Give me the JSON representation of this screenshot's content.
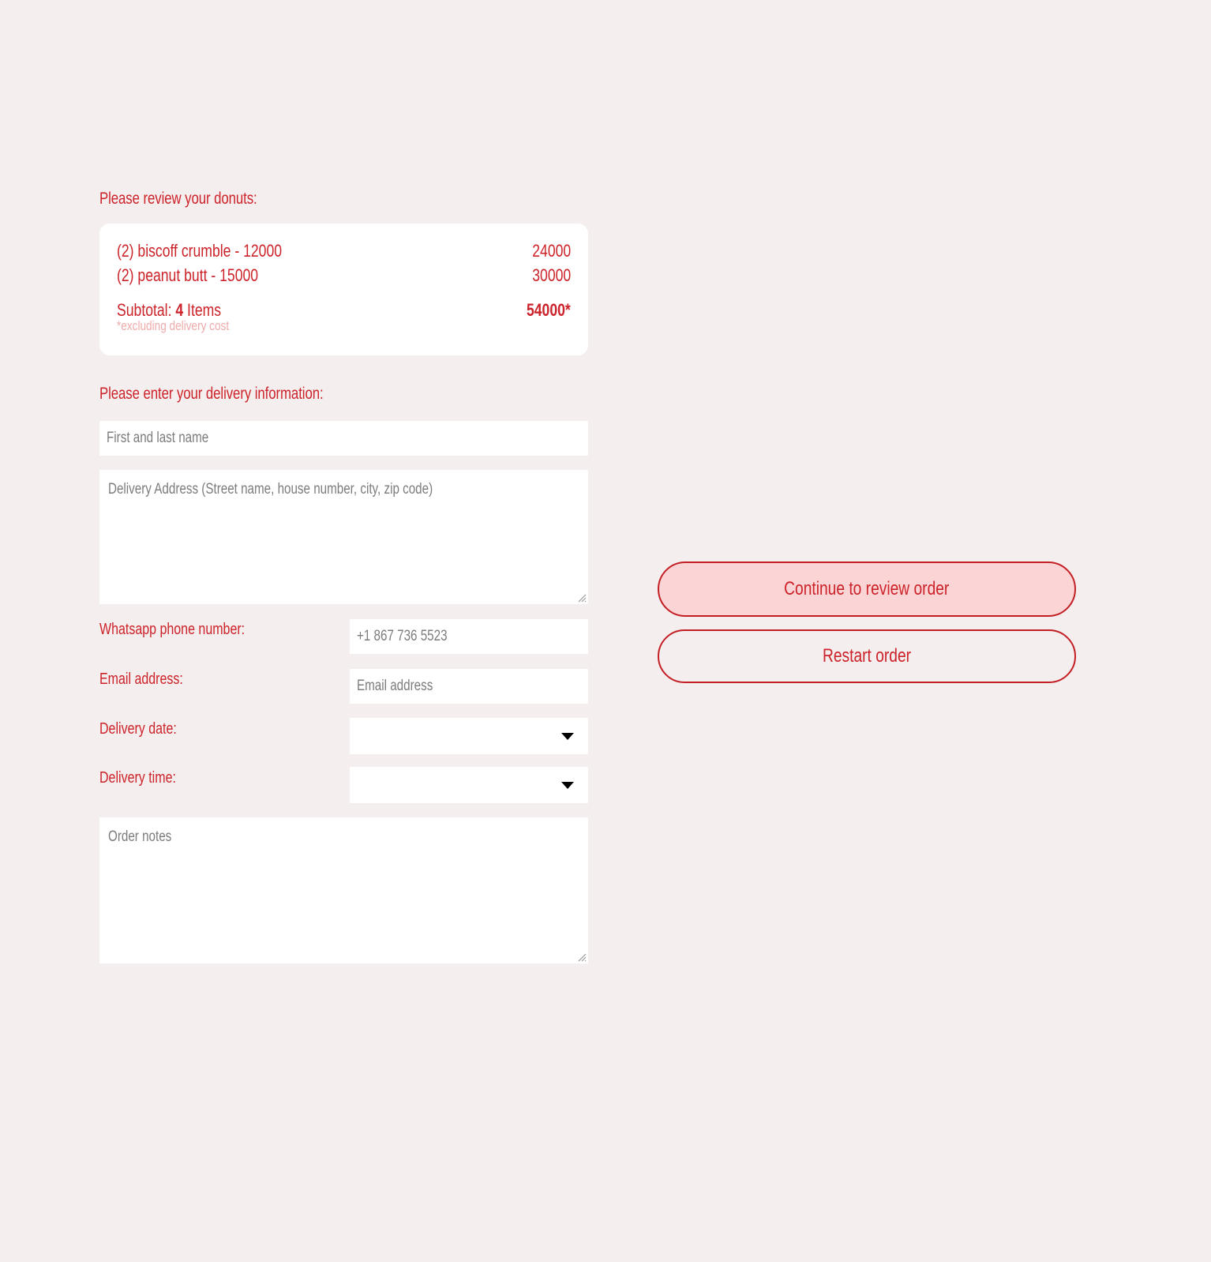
{
  "page": {
    "background_color": "#f5eeee",
    "accent_color": "#cc2229",
    "muted_color": "#eeabaa",
    "placeholder_color": "#7c7c7c",
    "button_fill_color": "#fbd5d5"
  },
  "review": {
    "heading": "Please review your donuts:",
    "items": [
      {
        "name": "(2) biscoff crumble - 12000",
        "amount": "24000"
      },
      {
        "name": "(2) peanut butt - 15000",
        "amount": "30000"
      }
    ],
    "subtotal": {
      "label_prefix": "Subtotal: ",
      "count": "4",
      "label_suffix": " Items",
      "amount": "54000*",
      "note": "*excluding delivery cost"
    }
  },
  "delivery": {
    "heading": "Please enter your delivery information:",
    "name_placeholder": "First and last name",
    "name_value": "",
    "address_placeholder": "Delivery Address (Street name, house number, city, zip code)",
    "address_value": "",
    "fields": [
      {
        "label": "Whatsapp phone number:",
        "placeholder": "+1 867 736 5523",
        "value": ""
      },
      {
        "label": "Email address:",
        "placeholder": "Email address",
        "value": ""
      },
      {
        "label": "Delivery date:",
        "selected": ""
      },
      {
        "label": "Delivery time:",
        "selected": ""
      }
    ],
    "notes_placeholder": "Order notes",
    "notes_value": ""
  },
  "actions": {
    "continue_label": "Continue to review order",
    "restart_label": "Restart order"
  },
  "icons": {
    "caret": "chevron-down-icon",
    "grip": "resize-handle-icon"
  }
}
